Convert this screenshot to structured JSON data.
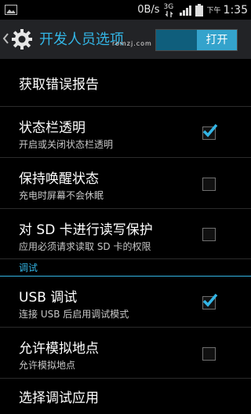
{
  "status_bar": {
    "data_rate": "0B/s",
    "network_type": "3G",
    "time_prefix": "下午",
    "time": "1:35",
    "icons": [
      "image-icon",
      "data-activity-icon",
      "signal-icon",
      "battery-icon"
    ]
  },
  "action_bar": {
    "title": "开发人员选项",
    "watermark": "romzj.com",
    "toggle_label": "打开"
  },
  "items": [
    {
      "title": "获取错误报告",
      "summary": "",
      "checked": null
    },
    {
      "title": "状态栏透明",
      "summary": "开启或关闭状态栏透明",
      "checked": true
    },
    {
      "title": "保持唤醒状态",
      "summary": "充电时屏幕不会休眠",
      "checked": false
    },
    {
      "title": "对 SD 卡进行读写保护",
      "summary": "应用必须请求读取 SD 卡的权限",
      "checked": false
    }
  ],
  "section": {
    "title": "调试"
  },
  "debug_items": [
    {
      "title": "USB 调试",
      "summary": "连接 USB 后启用调试模式",
      "checked": true
    },
    {
      "title": "允许模拟地点",
      "summary": "允许模拟地点",
      "checked": false
    },
    {
      "title": "选择调试应用",
      "summary": "",
      "checked": null
    }
  ],
  "colors": {
    "accent": "#33b5e5",
    "actionbar_bg": "#222326",
    "background": "#000000"
  }
}
